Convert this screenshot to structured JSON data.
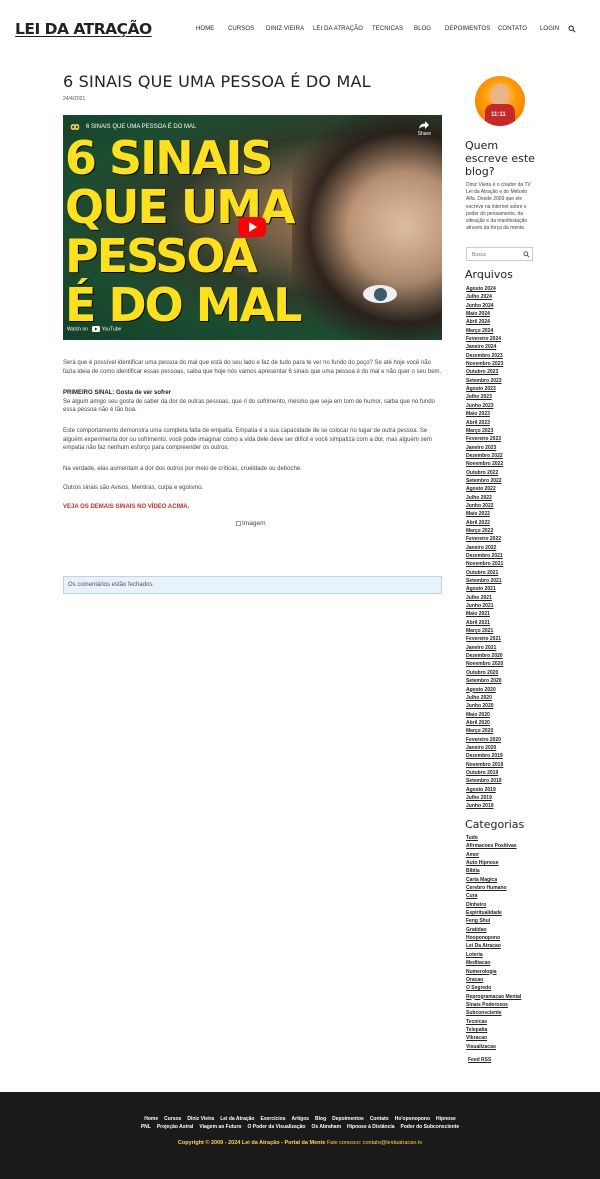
{
  "header": {
    "logo": "LEI DA ATRAÇÃO",
    "nav": [
      "HOME",
      "CURSOS",
      "DINIZ VIEIRA",
      "LEI DA ATRAÇÃO",
      "TECNICAS",
      "BLOG",
      "DEPOIMENTOS",
      "CONTATO",
      "LOGIN"
    ],
    "search_icon": "search-icon"
  },
  "post": {
    "title": "6 SINAIS QUE UMA PESSOA É DO MAL",
    "date": "24/4/2021",
    "video": {
      "title": "6 SINAIS QUE UMA PESSOA É DO MAL",
      "share": "Share",
      "watch_on": "Watch on",
      "platform": "YouTube",
      "thumb_lines": [
        "6 SINAIS",
        "QUE UMA",
        "PESSOA",
        "É DO MAL"
      ],
      "thumb_color": "#ffe11a"
    },
    "intro": "Será que é possível identificar uma pessoa do mal que está do seu lado e faz de tudo para te ver no fundo do poço? Se até hoje você não fazia ideia de como identificar essas pessoas, saiba que hoje nós vamos apresentar 6 sinais que uma pessoa é do mal e não quer o seu bem.",
    "first_sign_title": "PRIMEIRO SINAL: Gosta de ver sofrer",
    "first_sign_text": "Se algum amigo seu gosta de saber da dor de outras pessoas, que ri do sofrimento, mesmo que seja em tom de humor, saiba que no fundo essa pessoa não é tão boa.",
    "empathy": "Este comportamento demonstra uma completa falta de empatia. Empatia é a sua capacidade de se colocar no lugar de outra pessoa. Se alguém experimenta dor ou sofrimento, você pode imaginar como a vida dele deve ser difícil e você simpatiza com a dor, mas alguém sem empatia não faz nenhum esforço para compreender os outros.",
    "pain": "Na verdade, elas aumentam a dor dos outros por meio de críticas, crueldade ou deboche.",
    "others": "Outros sinais são Avisos, Mentiras, culpa e egoismo.",
    "see_video": "VEJA OS DEMAIS SINAIS NO VÍDEO ACIMA.",
    "image_alt": "Imagem",
    "comments_closed": "Os comentários estão fechados."
  },
  "sidebar": {
    "who_title": "Quem escreve este blog?",
    "who_text": "Diniz Vieira é o criador da TV Lei da Atração e do Método Alfa. Desde 2009 que ele escreve na internet sobre o poder do pensamento, da vibração e da manifestação através da força da mente.",
    "avatar_badge": "11:11",
    "search_placeholder": "Busca",
    "archives_title": "Arquivos",
    "archives": [
      "Agosto 2024",
      "Julho 2024",
      "Junho 2024",
      "Maio 2024",
      "Abril 2024",
      "Março 2024",
      "Fevereiro 2024",
      "Janeiro 2024",
      "Dezembro 2023",
      "Novembro 2023",
      "Outubro 2023",
      "Setembro 2023",
      "Agosto 2023",
      "Julho 2023",
      "Junho 2023",
      "Maio 2023",
      "Abril 2023",
      "Março 2023",
      "Fevereiro 2023",
      "Janeiro 2023",
      "Dezembro 2022",
      "Novembro 2022",
      "Outubro 2022",
      "Setembro 2022",
      "Agosto 2022",
      "Julho 2022",
      "Junho 2022",
      "Maio 2022",
      "Abril 2022",
      "Março 2022",
      "Fevereiro 2022",
      "Janeiro 2022",
      "Dezembro 2021",
      "Novembro 2021",
      "Outubro 2021",
      "Setembro 2021",
      "Agosto 2021",
      "Julho 2021",
      "Junho 2021",
      "Maio 2021",
      "Abril 2021",
      "Março 2021",
      "Fevereiro 2021",
      "Janeiro 2021",
      "Dezembro 2020",
      "Novembro 2020",
      "Outubro 2020",
      "Setembro 2020",
      "Agosto 2020",
      "Julho 2020",
      "Junho 2020",
      "Maio 2020",
      "Abril 2020",
      "Março 2020",
      "Fevereiro 2020",
      "Janeiro 2020",
      "Dezembro 2019",
      "Novembro 2019",
      "Outubro 2019",
      "Setembro 2019",
      "Agosto 2019",
      "Julho 2019",
      "Junho 2019"
    ],
    "categories_title": "Categorias",
    "categories": [
      "Tudo",
      "Afirmacoes Positivas",
      "Amor",
      "Auto Hipnose",
      "Biblia",
      "Carta Magica",
      "Cerebro Humano",
      "Cura",
      "Dinheiro",
      "Espiritualidade",
      "Feng Shui",
      "Gratidao",
      "Hooponopono",
      "Lei Da Atracao",
      "Loteria",
      "Meditacao",
      "Numerologia",
      "Oracao",
      "O Segredo",
      "Reprogramacao Mental",
      "Sinais Poderosos",
      "Subconsciente",
      "Tecnicas",
      "Telepatia",
      "Vibracao",
      "Visualizacao"
    ],
    "feed": "Feed RSS"
  },
  "footer": {
    "links_row1": [
      "Home",
      "Cursos",
      "Diniz Vieira",
      "Lei da Atração",
      "Exercícios",
      "Artigos",
      "Blog",
      "Depoimentos",
      "Contato",
      "Ho'oponopono",
      "Hipnose"
    ],
    "links_row2": [
      "PNL",
      "Projeção Astral",
      "Viagem ao Futuro",
      "O Poder da Visualização",
      "Os Abraham",
      "Hipnose à Distância",
      "Poder do Subconsciente"
    ],
    "copyright": "Copyright © 2009 - 2024 Lei da Atração - Portal da Mente",
    "contact": "Fale conosco: contato@leidaatracao.tv"
  }
}
